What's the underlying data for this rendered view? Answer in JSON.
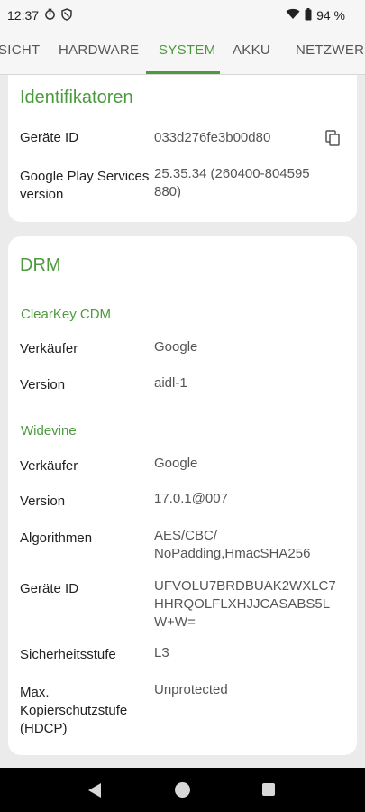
{
  "status": {
    "time": "12:37",
    "battery": "94 %"
  },
  "tabs": [
    {
      "label": "SICHT"
    },
    {
      "label": "HARDWARE"
    },
    {
      "label": "SYSTEM"
    },
    {
      "label": "AKKU"
    },
    {
      "label": "NETZWERK"
    }
  ],
  "active_tab": "SYSTEM",
  "identifiers": {
    "title": "Identifikatoren",
    "rows": [
      {
        "label": "Geräte ID",
        "value": "033d276fe3b00d80"
      },
      {
        "label": "Google Play Services version",
        "value": "25.35.34 (260400-804595880)"
      }
    ]
  },
  "drm": {
    "title": "DRM",
    "clearkey": {
      "title": "ClearKey CDM",
      "rows": [
        {
          "label": "Verkäufer",
          "value": "Google"
        },
        {
          "label": "Version",
          "value": "aidl-1"
        }
      ]
    },
    "widevine": {
      "title": "Widevine",
      "rows": [
        {
          "label": "Verkäufer",
          "value": "Google"
        },
        {
          "label": "Version",
          "value": "17.0.1@007"
        },
        {
          "label": "Algorithmen",
          "value": "AES/CBC/ NoPadding,HmacSHA256"
        },
        {
          "label": "Geräte ID",
          "value": "UFVOLU7BRDBUAK2WXLC7HHRQOLFLXHJJCASABS5LW+W="
        },
        {
          "label": "Sicherheitsstufe",
          "value": "L3"
        },
        {
          "label": "Max. Kopierschutzstufe (HDCP)",
          "value": "Unprotected"
        }
      ]
    }
  },
  "colors": {
    "accent": "#4c9a3d",
    "background": "#ebebeb",
    "card": "#ffffff"
  }
}
